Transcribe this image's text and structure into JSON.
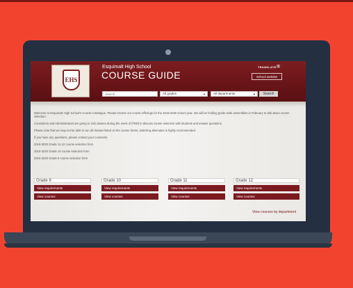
{
  "header": {
    "school_name": "Esquimalt High School",
    "title": "COURSE GUIDE",
    "translate_label": "TRANSLATE",
    "school_website_label": "School website",
    "logo_text": "EHS"
  },
  "search": {
    "placeholder": "Search",
    "grades_value": "All grades",
    "departments_value": "All departments",
    "button_label": "Search"
  },
  "content": {
    "welcome": "Welcome to Esquimalt High School's Course Catalogue. Please browse our course offerings for the 2019-2020 school year. We will be holding grade wide assemblies in February to talk about course selection.",
    "counselors": "Counselors and Administrators are going to visit classes during the week of [TBD] to discuss course selection with students and answer questions.",
    "note": "Please note that we may not be able to run all classes listed on the course forms; selecting alternates is highly recommended.",
    "questions": "If you have any questions, please contact your counselor.",
    "links": [
      "2019-2020 Grade 11-12 course selection form",
      "2019-2020 Grade 10 course selection form",
      "2019-2020 Grade 9 course selection form"
    ]
  },
  "grades": [
    {
      "title": "Grade 9",
      "requirements": "View requirements",
      "courses": "View courses"
    },
    {
      "title": "Grade 10",
      "requirements": "View requirements",
      "courses": "View courses"
    },
    {
      "title": "Grade 11",
      "requirements": "View requirements",
      "courses": "View courses"
    },
    {
      "title": "Grade 12",
      "requirements": "View requirements",
      "courses": "View courses"
    }
  ],
  "footer_link": "View courses by department",
  "colors": {
    "background": "#f2432f",
    "laptop": "#243041",
    "brand": "#7b1a20"
  },
  "icons": {
    "translate": "translate-icon",
    "camera": "camera-icon"
  }
}
